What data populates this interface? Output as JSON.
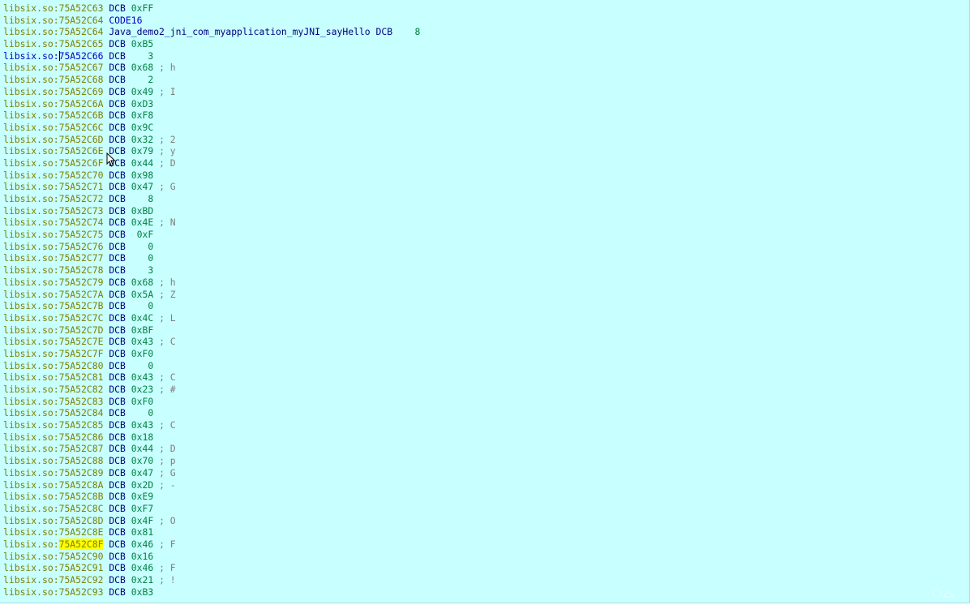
{
  "listing": {
    "segment": "libsix.so",
    "current_line_index": 4,
    "highlighted_line_index": 45,
    "lines": [
      {
        "addr": "75A52C63",
        "op": "DCB",
        "val": "0xFF",
        "cmt": ""
      },
      {
        "addr": "75A52C64",
        "op": "CODE16",
        "val": "",
        "cmt": ""
      },
      {
        "addr": "75A52C64",
        "op": "DCB",
        "label": "Java_demo2_jni_com_myapplication_myJNI_sayHello",
        "val": "   8",
        "cmt": ""
      },
      {
        "addr": "75A52C65",
        "op": "DCB",
        "val": "0xB5",
        "cmt": ""
      },
      {
        "addr": "75A52C66",
        "op": "DCB",
        "val": "   3",
        "cmt": ""
      },
      {
        "addr": "75A52C67",
        "op": "DCB",
        "val": "0x68",
        "cmt": "; h"
      },
      {
        "addr": "75A52C68",
        "op": "DCB",
        "val": "   2",
        "cmt": ""
      },
      {
        "addr": "75A52C69",
        "op": "DCB",
        "val": "0x49",
        "cmt": "; I"
      },
      {
        "addr": "75A52C6A",
        "op": "DCB",
        "val": "0xD3",
        "cmt": ""
      },
      {
        "addr": "75A52C6B",
        "op": "DCB",
        "val": "0xF8",
        "cmt": ""
      },
      {
        "addr": "75A52C6C",
        "op": "DCB",
        "val": "0x9C",
        "cmt": ""
      },
      {
        "addr": "75A52C6D",
        "op": "DCB",
        "val": "0x32",
        "cmt": "; 2"
      },
      {
        "addr": "75A52C6E",
        "op": "DCB",
        "val": "0x79",
        "cmt": "; y"
      },
      {
        "addr": "75A52C6F",
        "op": "DCB",
        "val": "0x44",
        "cmt": "; D"
      },
      {
        "addr": "75A52C70",
        "op": "DCB",
        "val": "0x98",
        "cmt": ""
      },
      {
        "addr": "75A52C71",
        "op": "DCB",
        "val": "0x47",
        "cmt": "; G"
      },
      {
        "addr": "75A52C72",
        "op": "DCB",
        "val": "   8",
        "cmt": ""
      },
      {
        "addr": "75A52C73",
        "op": "DCB",
        "val": "0xBD",
        "cmt": ""
      },
      {
        "addr": "75A52C74",
        "op": "DCB",
        "val": "0x4E",
        "cmt": "; N"
      },
      {
        "addr": "75A52C75",
        "op": "DCB",
        "val": " 0xF",
        "cmt": ""
      },
      {
        "addr": "75A52C76",
        "op": "DCB",
        "val": "   0",
        "cmt": ""
      },
      {
        "addr": "75A52C77",
        "op": "DCB",
        "val": "   0",
        "cmt": ""
      },
      {
        "addr": "75A52C78",
        "op": "DCB",
        "val": "   3",
        "cmt": ""
      },
      {
        "addr": "75A52C79",
        "op": "DCB",
        "val": "0x68",
        "cmt": "; h"
      },
      {
        "addr": "75A52C7A",
        "op": "DCB",
        "val": "0x5A",
        "cmt": "; Z"
      },
      {
        "addr": "75A52C7B",
        "op": "DCB",
        "val": "   0",
        "cmt": ""
      },
      {
        "addr": "75A52C7C",
        "op": "DCB",
        "val": "0x4C",
        "cmt": "; L"
      },
      {
        "addr": "75A52C7D",
        "op": "DCB",
        "val": "0xBF",
        "cmt": ""
      },
      {
        "addr": "75A52C7E",
        "op": "DCB",
        "val": "0x43",
        "cmt": "; C"
      },
      {
        "addr": "75A52C7F",
        "op": "DCB",
        "val": "0xF0",
        "cmt": ""
      },
      {
        "addr": "75A52C80",
        "op": "DCB",
        "val": "   0",
        "cmt": ""
      },
      {
        "addr": "75A52C81",
        "op": "DCB",
        "val": "0x43",
        "cmt": "; C"
      },
      {
        "addr": "75A52C82",
        "op": "DCB",
        "val": "0x23",
        "cmt": "; #"
      },
      {
        "addr": "75A52C83",
        "op": "DCB",
        "val": "0xF0",
        "cmt": ""
      },
      {
        "addr": "75A52C84",
        "op": "DCB",
        "val": "   0",
        "cmt": ""
      },
      {
        "addr": "75A52C85",
        "op": "DCB",
        "val": "0x43",
        "cmt": "; C"
      },
      {
        "addr": "75A52C86",
        "op": "DCB",
        "val": "0x18",
        "cmt": ""
      },
      {
        "addr": "75A52C87",
        "op": "DCB",
        "val": "0x44",
        "cmt": "; D"
      },
      {
        "addr": "75A52C88",
        "op": "DCB",
        "val": "0x70",
        "cmt": "; p"
      },
      {
        "addr": "75A52C89",
        "op": "DCB",
        "val": "0x47",
        "cmt": "; G"
      },
      {
        "addr": "75A52C8A",
        "op": "DCB",
        "val": "0x2D",
        "cmt": "; -"
      },
      {
        "addr": "75A52C8B",
        "op": "DCB",
        "val": "0xE9",
        "cmt": ""
      },
      {
        "addr": "75A52C8C",
        "op": "DCB",
        "val": "0xF7",
        "cmt": ""
      },
      {
        "addr": "75A52C8D",
        "op": "DCB",
        "val": "0x4F",
        "cmt": "; O"
      },
      {
        "addr": "75A52C8E",
        "op": "DCB",
        "val": "0x81",
        "cmt": ""
      },
      {
        "addr": "75A52C8F",
        "op": "DCB",
        "val": "0x46",
        "cmt": "; F"
      },
      {
        "addr": "75A52C90",
        "op": "DCB",
        "val": "0x16",
        "cmt": ""
      },
      {
        "addr": "75A52C91",
        "op": "DCB",
        "val": "0x46",
        "cmt": "; F"
      },
      {
        "addr": "75A52C92",
        "op": "DCB",
        "val": "0x21",
        "cmt": "; !"
      },
      {
        "addr": "75A52C93",
        "op": "DCB",
        "val": "0xB3",
        "cmt": ""
      }
    ]
  },
  "colors": {
    "background": "#c8ffff",
    "address": "#808000",
    "current_address": "#0000c0",
    "directive": "#000080",
    "value": "#008040",
    "comment": "#808080",
    "highlight": "#ffff00"
  }
}
